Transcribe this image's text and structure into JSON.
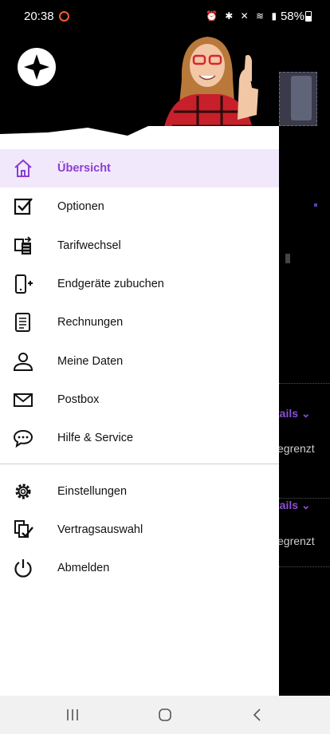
{
  "status_bar": {
    "time": "20:38",
    "battery": "58%"
  },
  "drawer": {
    "items_main": [
      {
        "label": "Übersicht",
        "icon": "home-icon",
        "active": true
      },
      {
        "label": "Optionen",
        "icon": "checkbox-icon"
      },
      {
        "label": "Tarifwechsel",
        "icon": "tariff-switch-icon"
      },
      {
        "label": "Endgeräte zubuchen",
        "icon": "add-device-icon"
      },
      {
        "label": "Rechnungen",
        "icon": "invoice-icon"
      },
      {
        "label": "Meine Daten",
        "icon": "user-icon"
      },
      {
        "label": "Postbox",
        "icon": "mail-icon"
      },
      {
        "label": "Hilfe & Service",
        "icon": "chat-icon"
      }
    ],
    "items_secondary": [
      {
        "label": "Einstellungen",
        "icon": "gear-icon"
      },
      {
        "label": "Vertragsauswahl",
        "icon": "contract-select-icon"
      },
      {
        "label": "Abmelden",
        "icon": "power-icon"
      }
    ]
  },
  "background": {
    "link1": "tails",
    "text1": "egrenzt",
    "link2": "tails",
    "text2": "egrenzt"
  },
  "colors": {
    "accent": "#8a3fd1",
    "active_bg": "#f2e8fc"
  }
}
